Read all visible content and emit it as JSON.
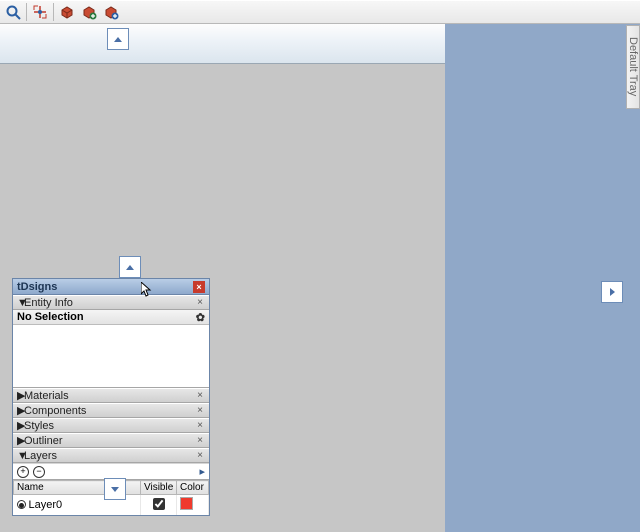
{
  "toolbar": {
    "icons": [
      "zoom",
      "zoom-extents",
      "component-browser",
      "3d-warehouse",
      "add-location"
    ]
  },
  "right_tab": {
    "label": "Default Tray"
  },
  "tray": {
    "title": "tDsigns",
    "entity_info": {
      "label": "Entity Info",
      "selection_text": "No Selection"
    },
    "panels": {
      "materials": "Materials",
      "components": "Components",
      "styles": "Styles",
      "outliner": "Outliner",
      "layers": "Layers"
    },
    "layers": {
      "columns": {
        "name": "Name",
        "visible": "Visible",
        "color": "Color"
      },
      "rows": [
        {
          "name": "Layer0",
          "visible": true,
          "color": "#ef3a2d"
        }
      ]
    }
  }
}
